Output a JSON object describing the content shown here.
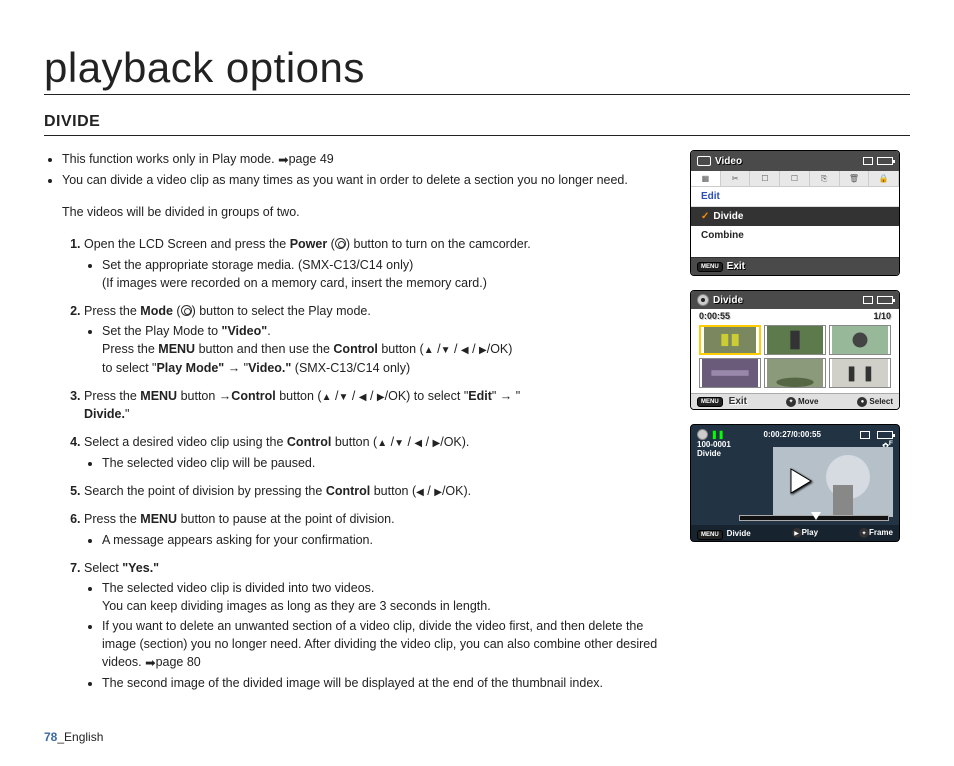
{
  "page_title": "playback options",
  "section_title": "DIVIDE",
  "intro": {
    "i1": "This function works only in Play mode.",
    "i1_ref": "page 49",
    "i2": "You can divide a video clip as many times as you want in order to delete a section you no longer need.",
    "i2b": "The videos will be divided in groups of two."
  },
  "steps": {
    "s1_a": "Open the LCD Screen and press the ",
    "s1_b": "Power",
    "s1_c": " button to turn on the camcorder.",
    "s1_sub1": "Set the appropriate storage media. (SMX-C13/C14 only)",
    "s1_sub1b": "(If images were recorded on a memory card, insert the memory card.)",
    "s2_a": "Press the ",
    "s2_b": "Mode",
    "s2_c": " button to select the Play mode.",
    "s2_sub1_a": "Set the Play Mode to ",
    "s2_sub1_b": "\"Video\"",
    "s2_sub1_c": ".",
    "s2_sub1_d": "Press the ",
    "s2_sub1_e": "MENU",
    "s2_sub1_f": " button and then use the ",
    "s2_sub1_g": "Control",
    "s2_sub1_h": " button (",
    "s2_sub1_i": "/OK)",
    "s2_sub1_j": "to select \"",
    "s2_sub1_k": "Play Mode\"",
    "s2_sub1_l": " → \"",
    "s2_sub1_m": "Video.\"",
    "s2_sub1_n": " (SMX-C13/C14 only)",
    "s3_a": "Press the ",
    "s3_b": "MENU",
    "s3_c": " button →",
    "s3_d": "Control",
    "s3_e": " button (",
    "s3_f": "/OK) to select \"",
    "s3_g": "Edit",
    "s3_h": "\" → \"",
    "s3_i": "Divide.",
    "s3_j": "\"",
    "s4_a": "Select a desired video clip using the ",
    "s4_b": "Control",
    "s4_c": " button (",
    "s4_d": "/OK).",
    "s4_sub1": "The selected video clip will be paused.",
    "s5_a": "Search the point of division by pressing the ",
    "s5_b": "Control",
    "s5_c": " button (",
    "s5_d": "/OK).",
    "s6_a": "Press the ",
    "s6_b": "MENU",
    "s6_c": " button to pause at the point of division.",
    "s6_sub1": "A message appears asking for your confirmation.",
    "s7_a": "Select ",
    "s7_b": "\"Yes.\"",
    "s7_sub1a": "The selected video clip is divided into two videos.",
    "s7_sub1b": "You can keep dividing images as long as they are 3 seconds in length.",
    "s7_sub2": "If you want to delete an unwanted section of a video clip, divide the video first, and then delete the image (section) you no longer need. After dividing the video clip, you can also combine other desired videos.",
    "s7_sub2_ref": "page 80",
    "s7_sub3": "The second image of the divided image will be displayed at the end of the thumbnail index."
  },
  "screen1": {
    "title": "Video",
    "edit": "Edit",
    "divide": "Divide",
    "combine": "Combine",
    "menu": "MENU",
    "exit": "Exit"
  },
  "screen2": {
    "title": "Divide",
    "time": "0:00:55",
    "count": "1/10",
    "menu": "MENU",
    "exit": "Exit",
    "move": "Move",
    "select": "Select"
  },
  "screen3": {
    "time": "0:00:27/0:00:55",
    "id": "100-0001",
    "label": "Divide",
    "focus": "F",
    "menu": "MENU",
    "divide": "Divide",
    "play": "Play",
    "frame": "Frame"
  },
  "footer": {
    "page": "78",
    "lang": "_English"
  }
}
